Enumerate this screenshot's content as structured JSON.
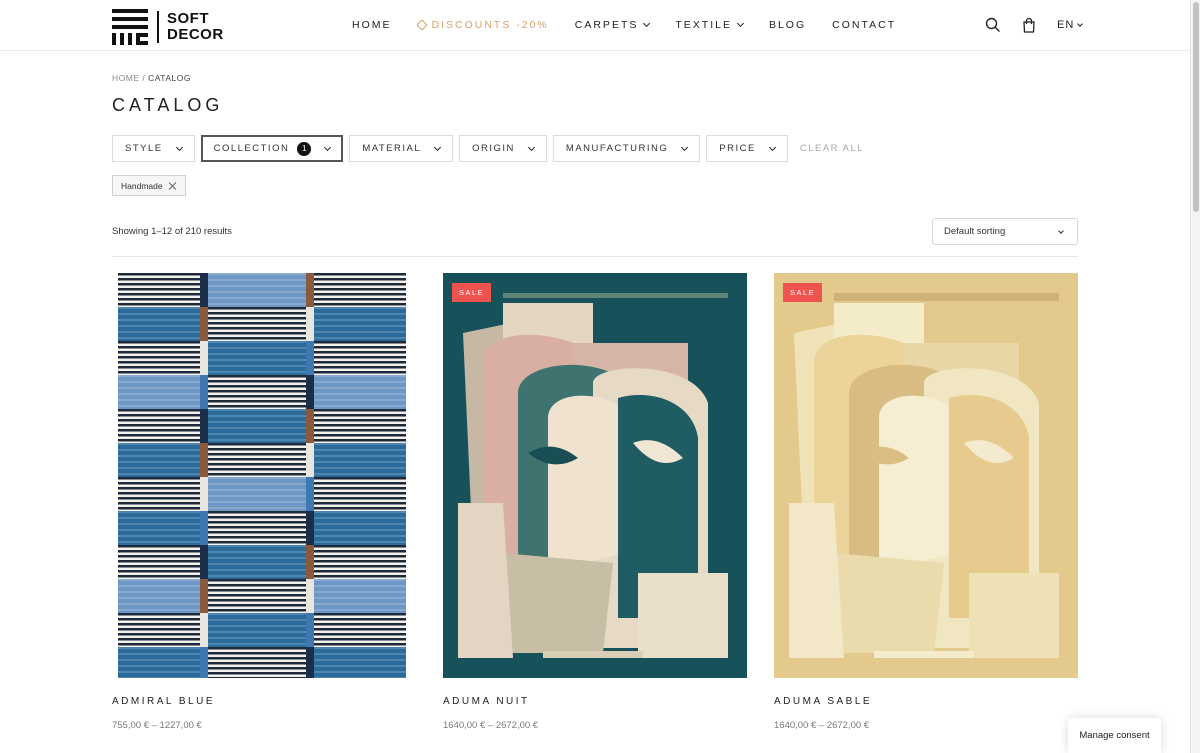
{
  "brand": {
    "line1": "SOFT",
    "line2": "DECOR"
  },
  "nav": {
    "items": [
      {
        "label": "HOME"
      },
      {
        "label": "DISCOUNTS -20%"
      },
      {
        "label": "CARPETS"
      },
      {
        "label": "TEXTILE"
      },
      {
        "label": "BLOG"
      },
      {
        "label": "CONTACT"
      }
    ],
    "language": "EN"
  },
  "breadcrumb": {
    "home": "HOME",
    "separator": "/",
    "current": "CATALOG"
  },
  "page_title": "CATALOG",
  "filters": {
    "items": [
      {
        "label": "STYLE"
      },
      {
        "label": "COLLECTION",
        "count": "1"
      },
      {
        "label": "MATERIAL"
      },
      {
        "label": "ORIGIN"
      },
      {
        "label": "MANUFACTURING"
      },
      {
        "label": "PRICE"
      }
    ],
    "clear_all": "CLEAR ALL",
    "active_chip": "Handmade"
  },
  "results": {
    "count_text": "Showing 1–12 of 210 results",
    "sort_selected": "Default sorting"
  },
  "products": [
    {
      "name": "ADMIRAL BLUE",
      "price": "755,00 € – 1227,00 €",
      "badge": ""
    },
    {
      "name": "ADUMA NUIT",
      "price": "1640,00 € – 2672,00 €",
      "badge": "SALE"
    },
    {
      "name": "ADUMA SABLE",
      "price": "1640,00 € – 2672,00 €",
      "badge": "SALE"
    }
  ],
  "consent_button": "Manage consent",
  "colors": {
    "accent_discount": "#d9a06b",
    "sale_badge": "#ef5350",
    "rug_blue": "#2d6ea0",
    "rug_teal": "#17525a",
    "rug_sand": "#e6cf8f"
  }
}
